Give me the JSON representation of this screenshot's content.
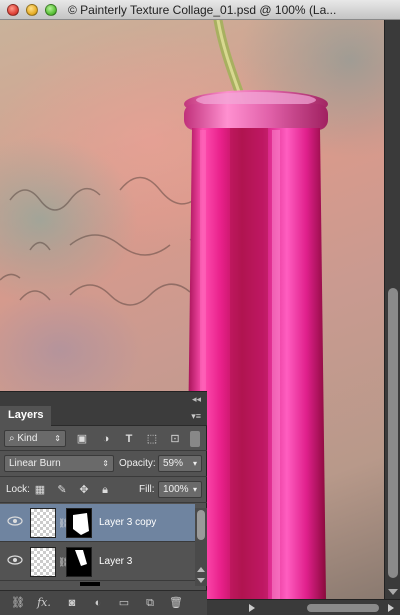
{
  "window": {
    "title": "© Painterly Texture Collage_01.psd @ 100% (La..."
  },
  "layers_panel": {
    "tab_label": "Layers",
    "filter": {
      "label": "Kind"
    },
    "blend_mode": "Linear Burn",
    "opacity": {
      "label": "Opacity:",
      "value": "59%"
    },
    "lock": {
      "label": "Lock:"
    },
    "fill": {
      "label": "Fill:",
      "value": "100%"
    },
    "layers": [
      {
        "name": "Layer 3 copy",
        "selected": true
      },
      {
        "name": "Layer 3",
        "selected": false
      }
    ],
    "footer_buttons": [
      "link-layers",
      "fx",
      "add-mask",
      "adjustment",
      "new-group",
      "new-layer",
      "delete-layer"
    ],
    "footer_fx_label": "fx."
  },
  "colors": {
    "panel_bg": "#535353",
    "selected_row": "#6f84a0",
    "bottle_pink": "#e8208a"
  }
}
